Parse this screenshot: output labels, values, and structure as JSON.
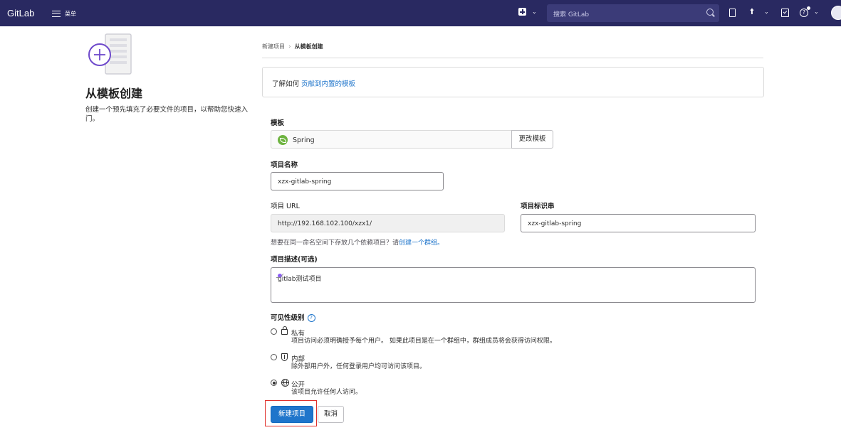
{
  "topbar": {
    "brand": "GitLab",
    "menu_label": "菜单",
    "search_placeholder": "搜索 GitLab"
  },
  "left": {
    "title": "从模板创建",
    "description": "创建一个预先填充了必要文件的项目，以帮助您快速入门。"
  },
  "breadcrumb": {
    "items": [
      "新建项目",
      "从模板创建"
    ]
  },
  "info": {
    "prefix": "了解如何 ",
    "link": "贡献到内置的模板"
  },
  "form": {
    "template_label": "模板",
    "template_name": "Spring",
    "change_template": "更改模板",
    "name_label": "项目名称",
    "name_value": "xzx-gitlab-spring",
    "url_label": "项目 URL",
    "url_value": "http://192.168.102.100/xzx1/",
    "slug_label": "项目标识串",
    "slug_value": "xzx-gitlab-spring",
    "hint_prefix": "想要在同一命名空间下存放几个依赖项目？请",
    "hint_link": "创建一个群组。",
    "desc_label": "项目描述(可选)",
    "desc_value": "gitlab测试项目",
    "visibility_label": "可见性级别",
    "visibility": [
      {
        "title": "私有",
        "desc": "项目访问必须明确授予每个用户。 如果此项目是在一个群组中，群组成员将会获得访问权限。"
      },
      {
        "title": "内部",
        "desc": "除外部用户外，任何登录用户均可访问该项目。"
      },
      {
        "title": "公开",
        "desc": "该项目允许任何人访问。"
      }
    ],
    "selected_visibility": "公开",
    "submit": "新建项目",
    "cancel": "取消"
  },
  "colors": {
    "nav_bg": "#292961",
    "primary": "#1f75cb",
    "highlight": "#e0312c",
    "spring": "#6db33f"
  },
  "icons": [
    "hamburger-icon",
    "plus-square-icon",
    "search-icon",
    "issues-icon",
    "merge-request-icon",
    "todo-icon",
    "help-icon",
    "spring-icon",
    "lock-icon",
    "shield-icon",
    "globe-icon",
    "question-icon"
  ]
}
